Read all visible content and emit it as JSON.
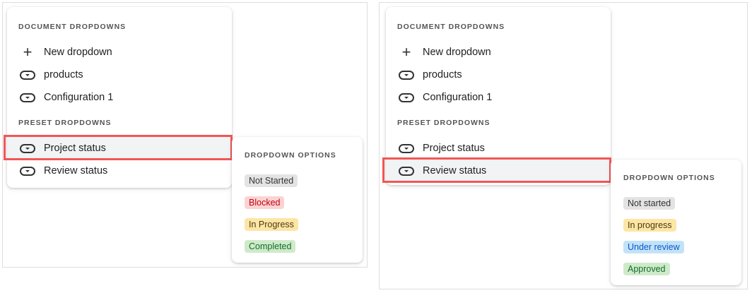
{
  "panels": [
    {
      "document_header": "DOCUMENT DROPDOWNS",
      "new_dropdown": "New dropdown",
      "document_items": [
        "products",
        "Configuration 1"
      ],
      "preset_header": "PRESET DROPDOWNS",
      "preset_items": [
        "Project status",
        "Review status"
      ],
      "selected": "Project status",
      "options_header": "DROPDOWN OPTIONS",
      "options": [
        {
          "label": "Not Started",
          "bg": "#e3e3e3",
          "fg": "#333333"
        },
        {
          "label": "Blocked",
          "bg": "#fbd3d3",
          "fg": "#c5000f"
        },
        {
          "label": "In Progress",
          "bg": "#fde5a4",
          "fg": "#4a3a10"
        },
        {
          "label": "Completed",
          "bg": "#cfeac9",
          "fg": "#146c2e"
        }
      ]
    },
    {
      "document_header": "DOCUMENT DROPDOWNS",
      "new_dropdown": "New dropdown",
      "document_items": [
        "products",
        "Configuration 1"
      ],
      "preset_header": "PRESET DROPDOWNS",
      "preset_items": [
        "Project status",
        "Review status"
      ],
      "selected": "Review status",
      "options_header": "DROPDOWN OPTIONS",
      "options": [
        {
          "label": "Not started",
          "bg": "#e3e3e3",
          "fg": "#333333"
        },
        {
          "label": "In progress",
          "bg": "#fde5a4",
          "fg": "#4a3a10"
        },
        {
          "label": "Under review",
          "bg": "#c2e3f7",
          "fg": "#0b57d0"
        },
        {
          "label": "Approved",
          "bg": "#cfeac9",
          "fg": "#146c2e"
        }
      ]
    }
  ]
}
